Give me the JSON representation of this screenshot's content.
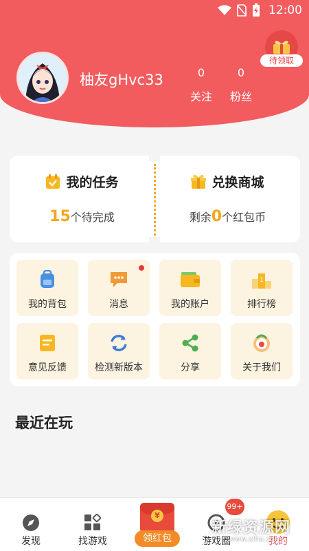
{
  "status": {
    "time": "12:00",
    "icons": [
      "wifi-icon",
      "no-sim-icon",
      "battery-charging-icon"
    ]
  },
  "profile": {
    "username": "柚友gHvc33",
    "follow_count": "0",
    "follow_label": "关注",
    "fans_count": "0",
    "fans_label": "粉丝",
    "reward_label": "待领取"
  },
  "tasks": {
    "my_tasks": {
      "title": "我的任务",
      "count": "15",
      "suffix": "个待完成"
    },
    "shop": {
      "title": "兑换商城",
      "prefix": "剩余",
      "count": "0",
      "suffix": "个红包币"
    }
  },
  "grid": [
    {
      "label": "我的背包",
      "icon": "backpack-icon"
    },
    {
      "label": "消息",
      "icon": "message-icon"
    },
    {
      "label": "我的账户",
      "icon": "wallet-icon"
    },
    {
      "label": "排行榜",
      "icon": "podium-icon"
    },
    {
      "label": "意见反馈",
      "icon": "feedback-icon"
    },
    {
      "label": "检测新版本",
      "icon": "refresh-icon"
    },
    {
      "label": "分享",
      "icon": "share-icon"
    },
    {
      "label": "关于我们",
      "icon": "about-icon"
    }
  ],
  "recent": {
    "title": "最近在玩"
  },
  "tabbar": {
    "items": [
      {
        "label": "发现",
        "icon": "compass-icon"
      },
      {
        "label": "找游戏",
        "icon": "grid-icon"
      },
      {
        "label": "领红包",
        "icon": "red-packet-icon"
      },
      {
        "label": "游戏圈",
        "icon": "circle-icon"
      },
      {
        "label": "我的",
        "icon": "smiley-icon"
      }
    ],
    "badge": "99+"
  },
  "watermark": {
    "text": "新绿资源网",
    "sub": "www.xlhs.com"
  },
  "colors": {
    "primary": "#f25c5f",
    "accent": "#f4a71b",
    "card_bg": "#fdf3e1"
  }
}
